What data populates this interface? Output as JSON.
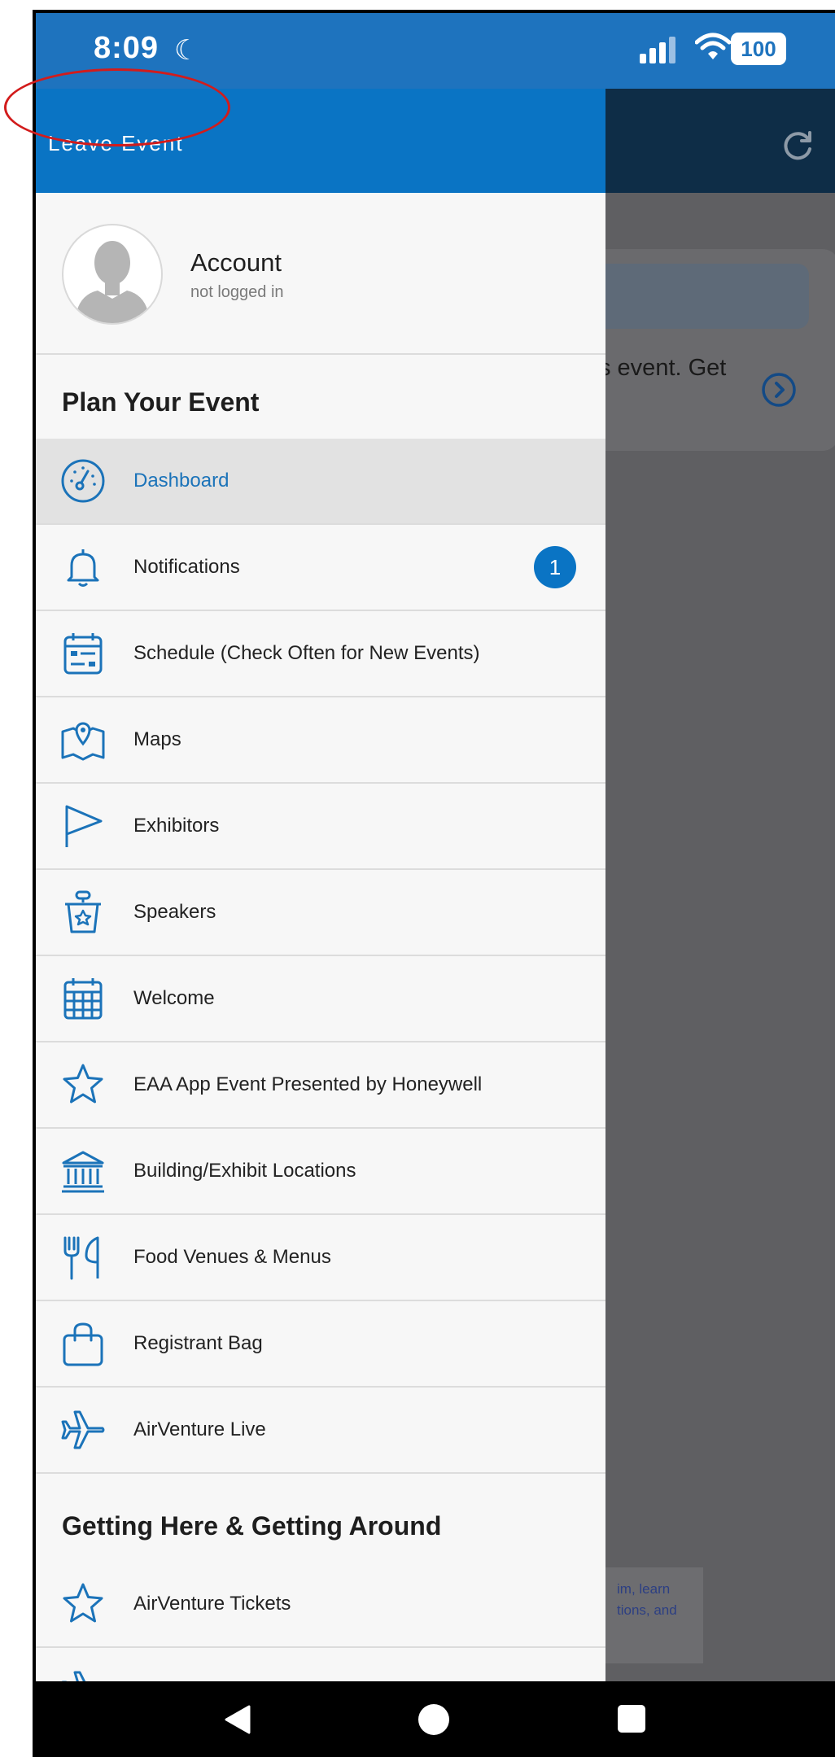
{
  "status_bar": {
    "time": "8:09",
    "battery": "100"
  },
  "header": {
    "leave_label": "Leave Event"
  },
  "account": {
    "title": "Account",
    "subtitle": "not logged in"
  },
  "sections": {
    "plan": "Plan Your Event",
    "getting": "Getting Here & Getting Around"
  },
  "menu": [
    {
      "label": "Dashboard",
      "icon": "dashboard-icon"
    },
    {
      "label": "Notifications",
      "icon": "bell-icon",
      "badge": "1"
    },
    {
      "label": "Schedule (Check Often for New Events)",
      "icon": "calendar-schedule-icon"
    },
    {
      "label": "Maps",
      "icon": "map-icon"
    },
    {
      "label": "Exhibitors",
      "icon": "flag-icon"
    },
    {
      "label": "Speakers",
      "icon": "speaker-podium-icon"
    },
    {
      "label": "Welcome",
      "icon": "calendar-grid-icon"
    },
    {
      "label": "EAA App Event Presented by Honeywell",
      "icon": "star-icon"
    },
    {
      "label": "Building/Exhibit Locations",
      "icon": "building-icon"
    },
    {
      "label": "Food Venues & Menus",
      "icon": "fork-knife-icon"
    },
    {
      "label": "Registrant Bag",
      "icon": "bag-icon"
    },
    {
      "label": "AirVenture Live",
      "icon": "airplane-icon"
    }
  ],
  "menu2": [
    {
      "label": "AirVenture Tickets",
      "icon": "star-icon"
    }
  ],
  "background": {
    "card_text": "s event. Get",
    "note_line1": "im, learn",
    "note_line2": "tions, and"
  },
  "colors": {
    "accent": "#0a74c4",
    "status_bar": "#1e73be",
    "highlight": "#d21c1c"
  }
}
